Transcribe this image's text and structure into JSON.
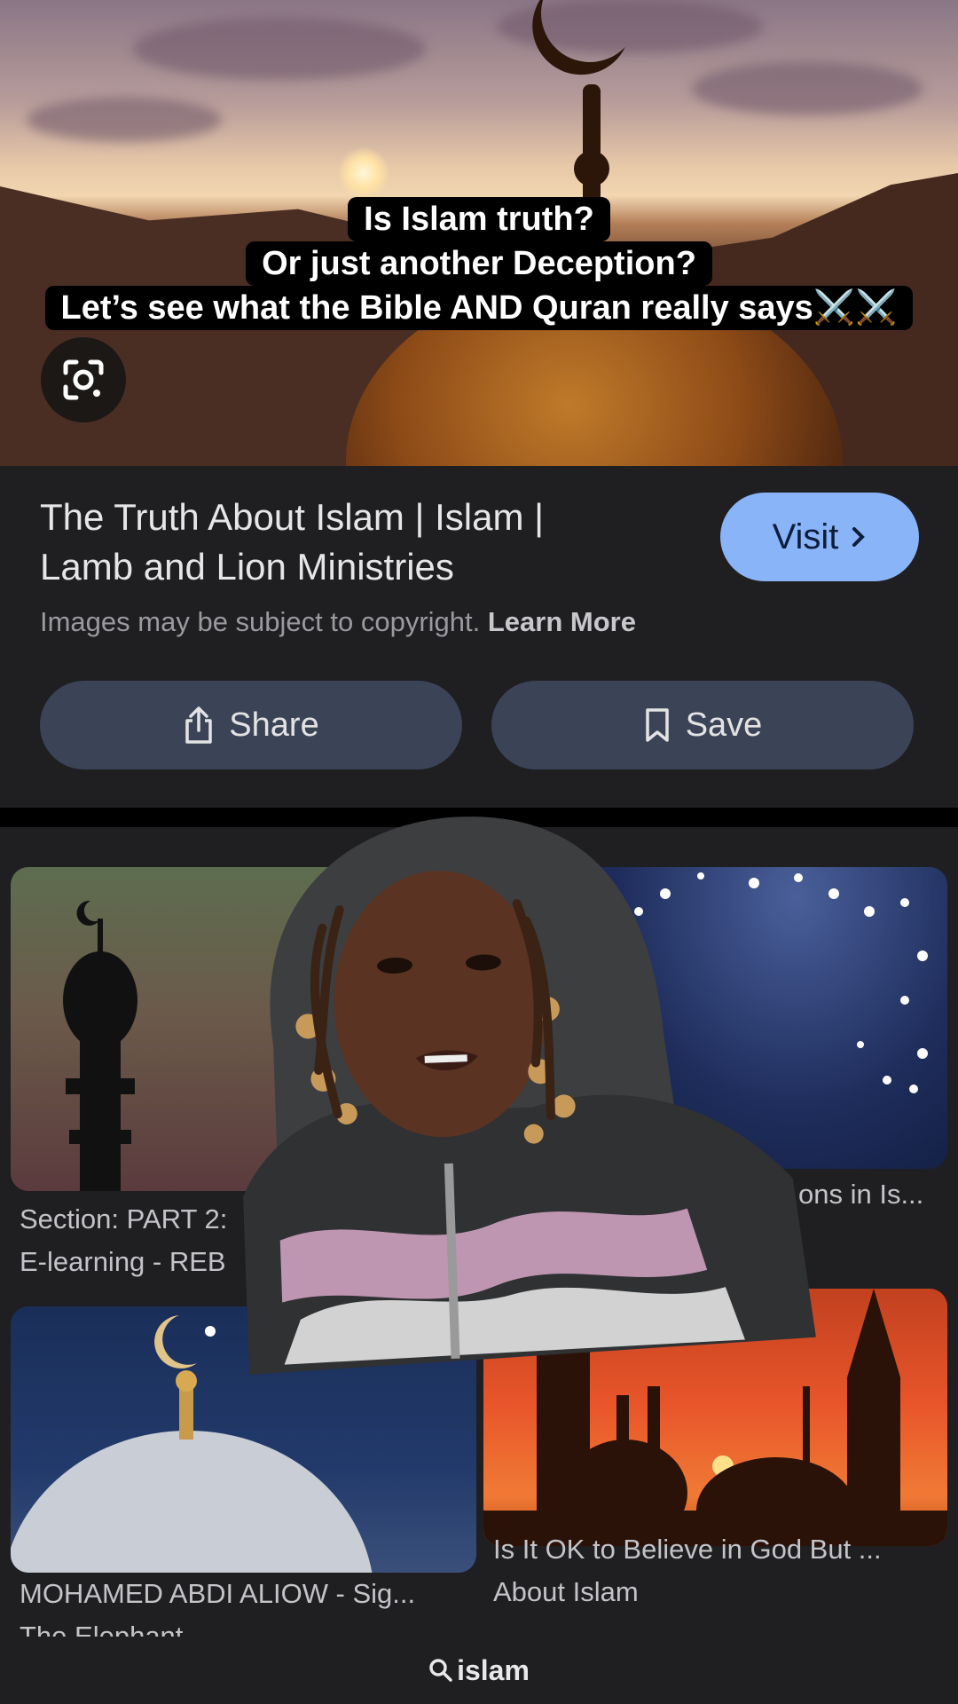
{
  "caption": {
    "line1": "Is Islam truth?",
    "line2": "Or just another Deception?",
    "line3": "Let’s see what the Bible AND Quran really says⚔️⚔️"
  },
  "result": {
    "title": "The Truth About Islam | Islam | Lamb and Lion Ministries",
    "visit_label": "Visit",
    "copyright_text": "Images may be subject to copyright.",
    "learn_more": "Learn More",
    "share_label": "Share",
    "save_label": "Save"
  },
  "related": [
    {
      "line1": "Section: PART 2:",
      "line2": "E-learning - REB"
    },
    {
      "line1": "ons in Is..."
    },
    {
      "line1": "MOHAMED ABDI ALIOW - Sig...",
      "line2": "The Elephant"
    },
    {
      "line1": "Is It OK to Believe in God But ...",
      "line2": "About Islam"
    }
  ],
  "search": {
    "query": "islam"
  },
  "icons": {
    "lens": "google-lens-icon",
    "share": "share-icon",
    "save": "bookmark-icon",
    "visit": "chevron-right-icon",
    "search": "search-icon"
  },
  "colors": {
    "accent": "#8ab4f8",
    "pill": "#3b4457",
    "background": "#1f1f22"
  }
}
